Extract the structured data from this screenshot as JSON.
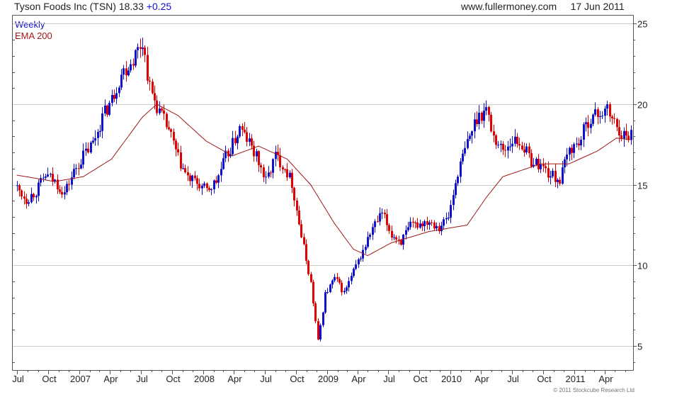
{
  "header": {
    "company": "Tyson Foods Inc (TSN)",
    "price": "18.33",
    "change": "+0.25",
    "site": "www.fullermoney.com",
    "date": "17 Jun 2011"
  },
  "legend": {
    "series1": "Weekly",
    "series2": "EMA 200"
  },
  "copyright": "© 2011 Stockcube Research Ltd",
  "colors": {
    "up": "#1010d0",
    "down": "#e00000",
    "ema": "#a01818",
    "grid": "#cccccc"
  },
  "chart_data": {
    "type": "line",
    "title": "",
    "xlabel": "",
    "ylabel": "",
    "ylim": [
      3.5,
      25.5
    ],
    "y_ticks": [
      5,
      10,
      15,
      20,
      25
    ],
    "x_ticks": [
      "Jul",
      "Oct",
      "2007",
      "Apr",
      "Jul",
      "Oct",
      "2008",
      "Apr",
      "Jul",
      "Oct",
      "2009",
      "Apr",
      "Jul",
      "Oct",
      "2010",
      "Apr",
      "Jul",
      "Oct",
      "2011",
      "Apr"
    ],
    "grid": true,
    "legend_position": "top-left",
    "series": [
      {
        "name": "Weekly",
        "points": [
          [
            "2006-06-30",
            14.8
          ],
          [
            "2006-07-28",
            14.1
          ],
          [
            "2006-08-25",
            14.6
          ],
          [
            "2006-09-22",
            15.6
          ],
          [
            "2006-10-20",
            15.2
          ],
          [
            "2006-11-17",
            14.5
          ],
          [
            "2006-12-15",
            15.8
          ],
          [
            "2007-01-12",
            16.8
          ],
          [
            "2007-02-09",
            17.6
          ],
          [
            "2007-03-09",
            19.2
          ],
          [
            "2007-04-06",
            20.3
          ],
          [
            "2007-05-04",
            21.9
          ],
          [
            "2007-06-01",
            22.6
          ],
          [
            "2007-07-06",
            23.9
          ],
          [
            "2007-07-27",
            21.0
          ],
          [
            "2007-08-24",
            19.5
          ],
          [
            "2007-09-21",
            18.4
          ],
          [
            "2007-10-19",
            16.6
          ],
          [
            "2007-11-16",
            15.4
          ],
          [
            "2007-12-14",
            15.1
          ],
          [
            "2008-01-11",
            14.6
          ],
          [
            "2008-02-08",
            15.2
          ],
          [
            "2008-03-07",
            16.7
          ],
          [
            "2008-03-28",
            17.5
          ],
          [
            "2008-04-18",
            18.5
          ],
          [
            "2008-05-16",
            17.6
          ],
          [
            "2008-06-13",
            16.4
          ],
          [
            "2008-07-04",
            15.2
          ],
          [
            "2008-08-01",
            16.8
          ],
          [
            "2008-08-29",
            16.1
          ],
          [
            "2008-09-19",
            15.1
          ],
          [
            "2008-10-17",
            11.8
          ],
          [
            "2008-11-14",
            8.9
          ],
          [
            "2008-12-05",
            5.3
          ],
          [
            "2008-12-26",
            8.2
          ],
          [
            "2009-01-23",
            9.2
          ],
          [
            "2009-02-20",
            8.3
          ],
          [
            "2009-03-20",
            9.6
          ],
          [
            "2009-04-17",
            10.9
          ],
          [
            "2009-05-15",
            12.3
          ],
          [
            "2009-06-12",
            13.2
          ],
          [
            "2009-07-10",
            11.9
          ],
          [
            "2009-08-07",
            11.5
          ],
          [
            "2009-09-04",
            12.4
          ],
          [
            "2009-10-02",
            12.6
          ],
          [
            "2009-10-30",
            12.8
          ],
          [
            "2009-11-27",
            12.4
          ],
          [
            "2009-12-25",
            13.0
          ],
          [
            "2010-01-22",
            15.8
          ],
          [
            "2010-02-19",
            17.6
          ],
          [
            "2010-03-19",
            19.2
          ],
          [
            "2010-04-16",
            19.7
          ],
          [
            "2010-05-07",
            18.0
          ],
          [
            "2010-06-04",
            17.1
          ],
          [
            "2010-07-02",
            17.8
          ],
          [
            "2010-07-30",
            17.5
          ],
          [
            "2010-08-27",
            16.5
          ],
          [
            "2010-09-24",
            16.2
          ],
          [
            "2010-10-22",
            15.6
          ],
          [
            "2010-11-19",
            15.3
          ],
          [
            "2010-12-17",
            17.2
          ],
          [
            "2011-01-14",
            17.6
          ],
          [
            "2011-02-11",
            19.0
          ],
          [
            "2011-03-11",
            19.4
          ],
          [
            "2011-04-08",
            19.6
          ],
          [
            "2011-05-06",
            18.6
          ],
          [
            "2011-06-03",
            17.9
          ],
          [
            "2011-06-17",
            18.33
          ]
        ]
      },
      {
        "name": "EMA 200",
        "points": [
          [
            "2006-06-30",
            15.6
          ],
          [
            "2006-10-20",
            15.2
          ],
          [
            "2007-01-12",
            15.5
          ],
          [
            "2007-04-06",
            16.6
          ],
          [
            "2007-07-06",
            19.2
          ],
          [
            "2007-08-17",
            20.0
          ],
          [
            "2007-10-19",
            19.3
          ],
          [
            "2008-01-11",
            17.7
          ],
          [
            "2008-03-28",
            16.8
          ],
          [
            "2008-06-13",
            17.4
          ],
          [
            "2008-09-05",
            16.6
          ],
          [
            "2008-11-14",
            15.0
          ],
          [
            "2009-01-23",
            12.6
          ],
          [
            "2009-03-20",
            11.0
          ],
          [
            "2009-05-01",
            10.6
          ],
          [
            "2009-07-10",
            11.4
          ],
          [
            "2009-10-30",
            12.1
          ],
          [
            "2010-02-19",
            12.5
          ],
          [
            "2010-04-16",
            14.2
          ],
          [
            "2010-06-04",
            15.5
          ],
          [
            "2010-09-24",
            16.3
          ],
          [
            "2010-12-17",
            16.3
          ],
          [
            "2011-03-11",
            17.1
          ],
          [
            "2011-05-06",
            17.9
          ],
          [
            "2011-06-17",
            17.8
          ]
        ]
      }
    ]
  }
}
